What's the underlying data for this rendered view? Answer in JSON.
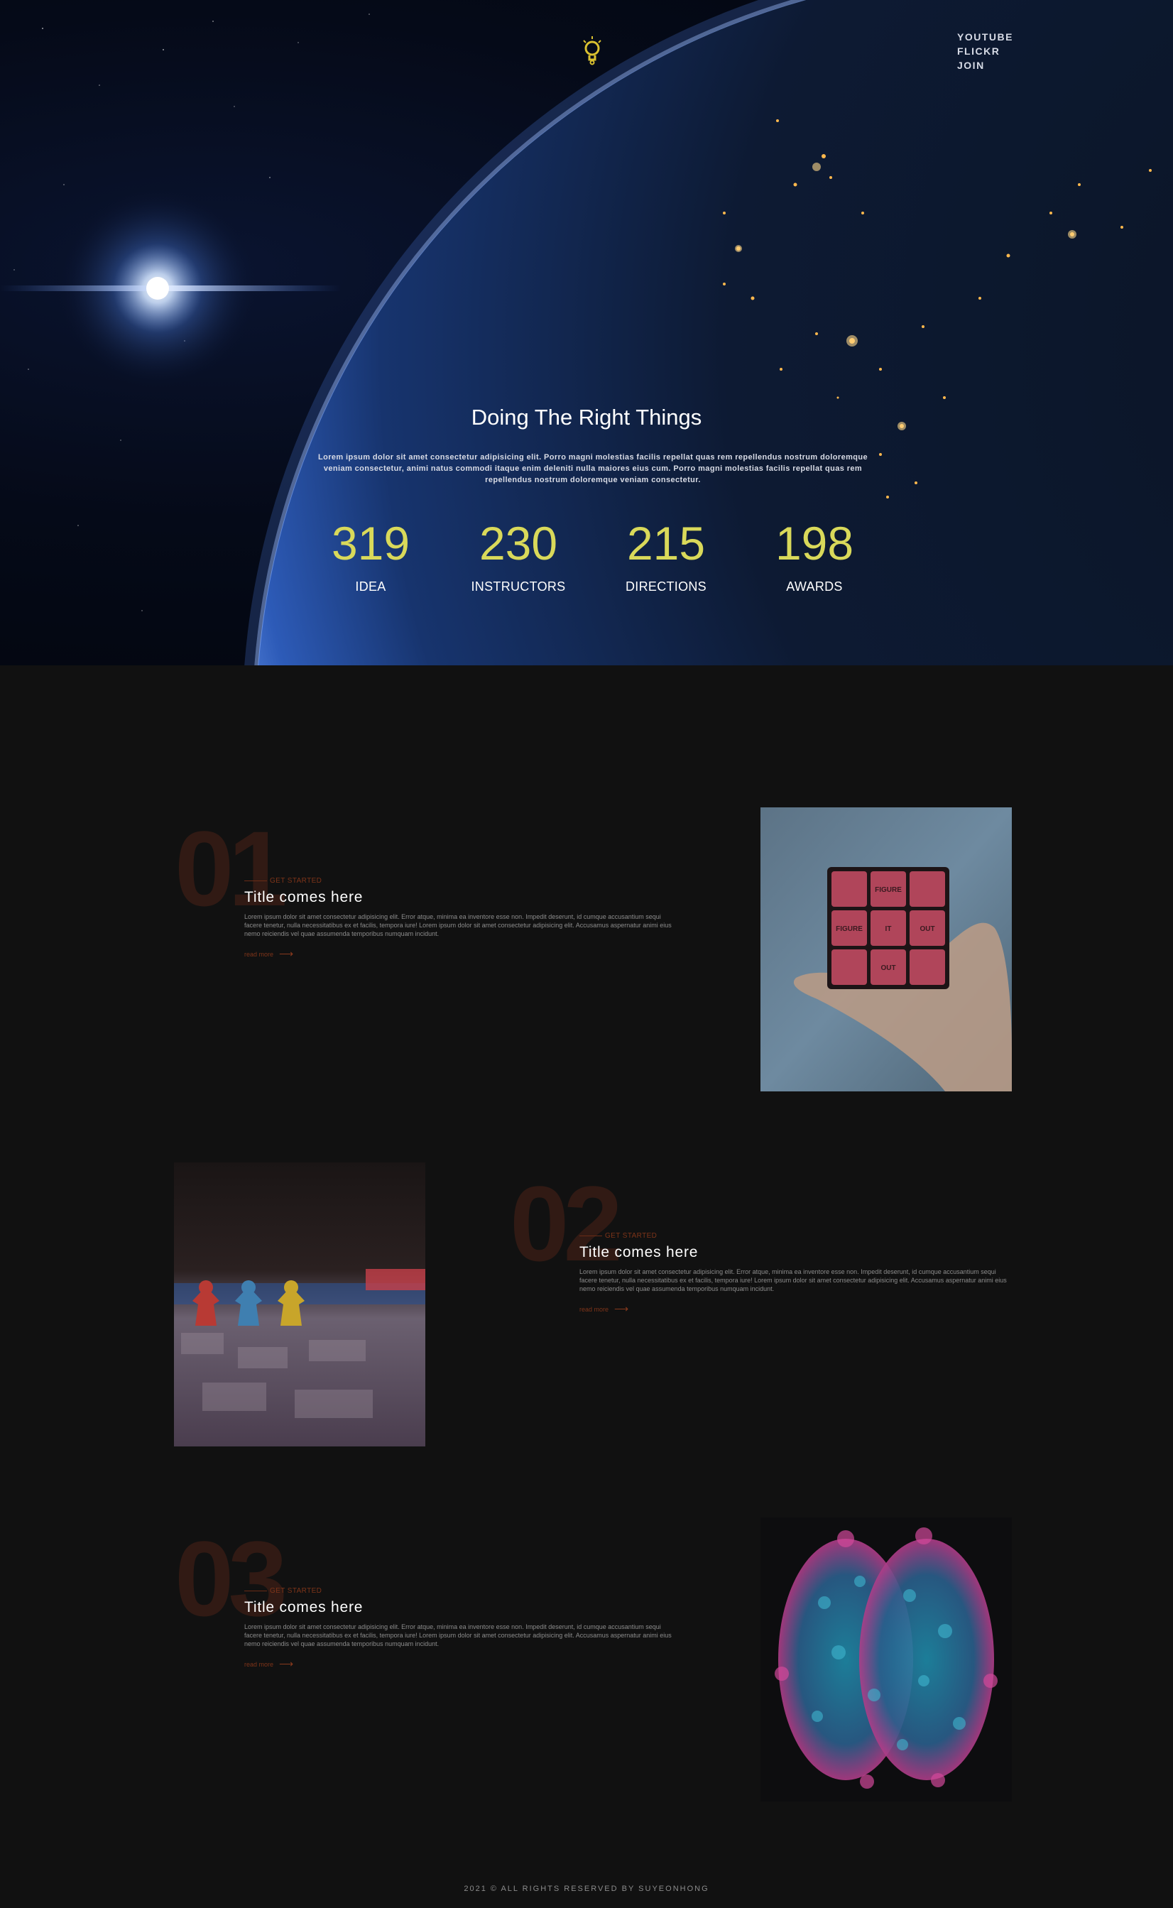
{
  "nav": {
    "logo_icon": "lightbulb-icon",
    "links": [
      "YOUTUBE",
      "FLICKR",
      "JOIN"
    ]
  },
  "hero": {
    "title": "Doing The Right Things",
    "text": "Lorem ipsum dolor sit amet consectetur adipisicing elit. Porro magni molestias facilis repellat quas rem repellendus nostrum doloremque veniam consectetur, animi natus commodi itaque enim deleniti nulla maiores eius cum. Porro magni molestias facilis repellat quas rem repellendus nostrum doloremque veniam consectetur.",
    "stats": [
      {
        "value": "319",
        "label": "IDEA"
      },
      {
        "value": "230",
        "label": "INSTRUCTORS"
      },
      {
        "value": "215",
        "label": "DIRECTIONS"
      },
      {
        "value": "198",
        "label": "AWARDS"
      }
    ]
  },
  "features": [
    {
      "number": "01",
      "eyebrow": "GET STARTED",
      "title": "Title comes here",
      "body": "Lorem ipsum dolor sit amet consectetur adipisicing elit. Error atque, minima ea inventore esse non. Impedit deserunt, id cumque accusantium sequi facere tenetur, nulla necessitatibus ex et facilis, tempora iure! Lorem ipsum dolor sit amet consectetur adipisicing elit. Accusamus aspernatur animi eius nemo reiciendis vel quae assumenda temporibus numquam incidunt.",
      "read_more": "read more",
      "image_words": [
        "FIGURE",
        "FIGURE",
        "IT",
        "OUT",
        "OUT"
      ]
    },
    {
      "number": "02",
      "eyebrow": "GET STARTED",
      "title": "Title comes here",
      "body": "Lorem ipsum dolor sit amet consectetur adipisicing elit. Error atque, minima ea inventore esse non. Impedit deserunt, id cumque accusantium sequi facere tenetur, nulla necessitatibus ex et facilis, tempora iure! Lorem ipsum dolor sit amet consectetur adipisicing elit. Accusamus aspernatur animi eius nemo reiciendis vel quae assumenda temporibus numquam incidunt.",
      "read_more": "read more"
    },
    {
      "number": "03",
      "eyebrow": "GET STARTED",
      "title": "Title comes here",
      "body": "Lorem ipsum dolor sit amet consectetur adipisicing elit. Error atque, minima ea inventore esse non. Impedit deserunt, id cumque accusantium sequi facere tenetur, nulla necessitatibus ex et facilis, tempora iure! Lorem ipsum dolor sit amet consectetur adipisicing elit. Accusamus aspernatur animi eius nemo reiciendis vel quae assumenda temporibus numquam incidunt.",
      "read_more": "read more"
    }
  ],
  "footer": {
    "text": "2021 © ALL RIGHTS RESERVED BY SUYEONHONG"
  },
  "colors": {
    "accent_yellow": "#d9d95a",
    "accent_rust": "#7e3419",
    "background": "#111111",
    "big_number": "#311a14"
  }
}
